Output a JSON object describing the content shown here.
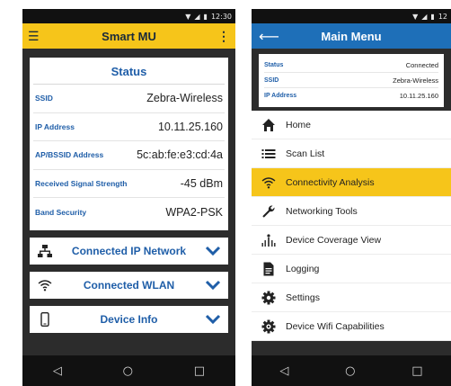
{
  "left_phone": {
    "statusbar": {
      "time": "12:30"
    },
    "appbar": {
      "title": "Smart MU"
    },
    "status": {
      "title": "Status",
      "rows": [
        {
          "key": "SSID",
          "value": "Zebra-Wireless"
        },
        {
          "key": "IP Address",
          "value": "10.11.25.160"
        },
        {
          "key": "AP/BSSID Address",
          "value": "5c:ab:fe:e3:cd:4a"
        },
        {
          "key": "Received Signal Strength",
          "value": "-45 dBm"
        },
        {
          "key": "Band Security",
          "value": "WPA2-PSK"
        }
      ]
    },
    "sections": [
      {
        "label": "Connected IP Network",
        "icon": "network-icon"
      },
      {
        "label": "Connected WLAN",
        "icon": "wifi-icon"
      },
      {
        "label": "Device Info",
        "icon": "phone-icon"
      }
    ]
  },
  "right_phone": {
    "statusbar": {
      "time": "12"
    },
    "appbar": {
      "title": "Main Menu"
    },
    "status_rows": [
      {
        "key": "Status",
        "value": "Connected"
      },
      {
        "key": "SSID",
        "value": "Zebra-Wireless"
      },
      {
        "key": "IP Address",
        "value": "10.11.25.160"
      }
    ],
    "menu": [
      {
        "label": "Home",
        "icon": "home-icon",
        "active": false
      },
      {
        "label": "Scan List",
        "icon": "list-icon",
        "active": false
      },
      {
        "label": "Connectivity Analysis",
        "icon": "wifi-icon",
        "active": true
      },
      {
        "label": "Networking Tools",
        "icon": "wrench-icon",
        "active": false
      },
      {
        "label": "Device Coverage View",
        "icon": "coverage-icon",
        "active": false
      },
      {
        "label": "Logging",
        "icon": "document-icon",
        "active": false
      },
      {
        "label": "Settings",
        "icon": "gear-icon",
        "active": false
      },
      {
        "label": "Device Wifi Capabilities",
        "icon": "gear-badge-icon",
        "active": false
      }
    ]
  },
  "colors": {
    "accent_yellow": "#f6c51a",
    "primary_blue": "#1e6fb8",
    "label_blue": "#1f5ea8"
  }
}
